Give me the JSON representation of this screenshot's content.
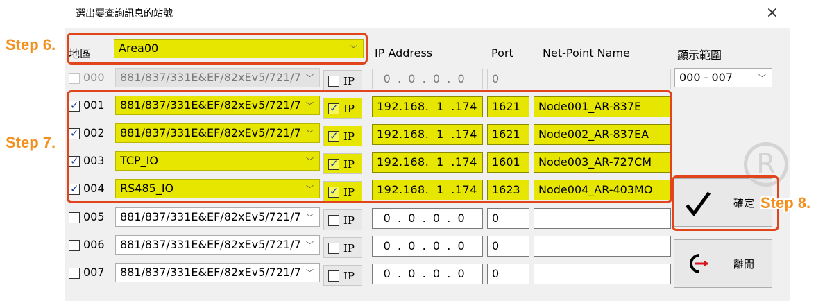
{
  "dialog": {
    "title": "選出要查詢訊息的站號",
    "close_glyph": "×"
  },
  "header": {
    "area_label": "地區",
    "area_value": "Area00",
    "ip_label": "IP Address",
    "port_label": "Port",
    "netpoint_label": "Net-Point Name",
    "display_label": "顯示範圍",
    "display_value": "000 - 007"
  },
  "rows": [
    {
      "num": "000",
      "checked": false,
      "module": "881/837/331E&EF/82xEv5/721/7.",
      "ip_checked": false,
      "ip_btn": "IP",
      "ip": [
        "0",
        "0",
        "0",
        "0"
      ],
      "port": "0",
      "name": ""
    },
    {
      "num": "001",
      "checked": true,
      "module": "881/837/331E&EF/82xEv5/721/7.",
      "ip_checked": true,
      "ip_btn": "IP",
      "ip": [
        "192",
        "168",
        "1",
        "174"
      ],
      "port": "1621",
      "name": "Node001_AR-837E"
    },
    {
      "num": "002",
      "checked": true,
      "module": "881/837/331E&EF/82xEv5/721/7.",
      "ip_checked": true,
      "ip_btn": "IP",
      "ip": [
        "192",
        "168",
        "1",
        "174"
      ],
      "port": "1621",
      "name": "Node002_AR-837EA"
    },
    {
      "num": "003",
      "checked": true,
      "module": "TCP_IO",
      "ip_checked": true,
      "ip_btn": "IP",
      "ip": [
        "192",
        "168",
        "1",
        "174"
      ],
      "port": "1601",
      "name": "Node003_AR-727CM"
    },
    {
      "num": "004",
      "checked": true,
      "module": "RS485_IO",
      "ip_checked": true,
      "ip_btn": "IP",
      "ip": [
        "192",
        "168",
        "1",
        "174"
      ],
      "port": "1623",
      "name": "Node004_AR-403MO"
    },
    {
      "num": "005",
      "checked": false,
      "module": "881/837/331E&EF/82xEv5/721/7.",
      "ip_checked": false,
      "ip_btn": "IP",
      "ip": [
        "0",
        "0",
        "0",
        "0"
      ],
      "port": "0",
      "name": ""
    },
    {
      "num": "006",
      "checked": false,
      "module": "881/837/331E&EF/82xEv5/721/7.",
      "ip_checked": false,
      "ip_btn": "IP",
      "ip": [
        "0",
        "0",
        "0",
        "0"
      ],
      "port": "0",
      "name": ""
    },
    {
      "num": "007",
      "checked": false,
      "module": "881/837/331E&EF/82xEv5/721/7.",
      "ip_checked": false,
      "ip_btn": "IP",
      "ip": [
        "0",
        "0",
        "0",
        "0"
      ],
      "port": "0",
      "name": ""
    }
  ],
  "buttons": {
    "confirm": "確定",
    "exit": "離開"
  },
  "steps": {
    "step6": "Step 6.",
    "step7": "Step 7.",
    "step8": "Step 8."
  },
  "colors": {
    "highlight": "#e6e600",
    "outline": "#e0451c",
    "step_text": "#f39020",
    "check_tick": "#1a3d9e"
  },
  "watermark": "R"
}
